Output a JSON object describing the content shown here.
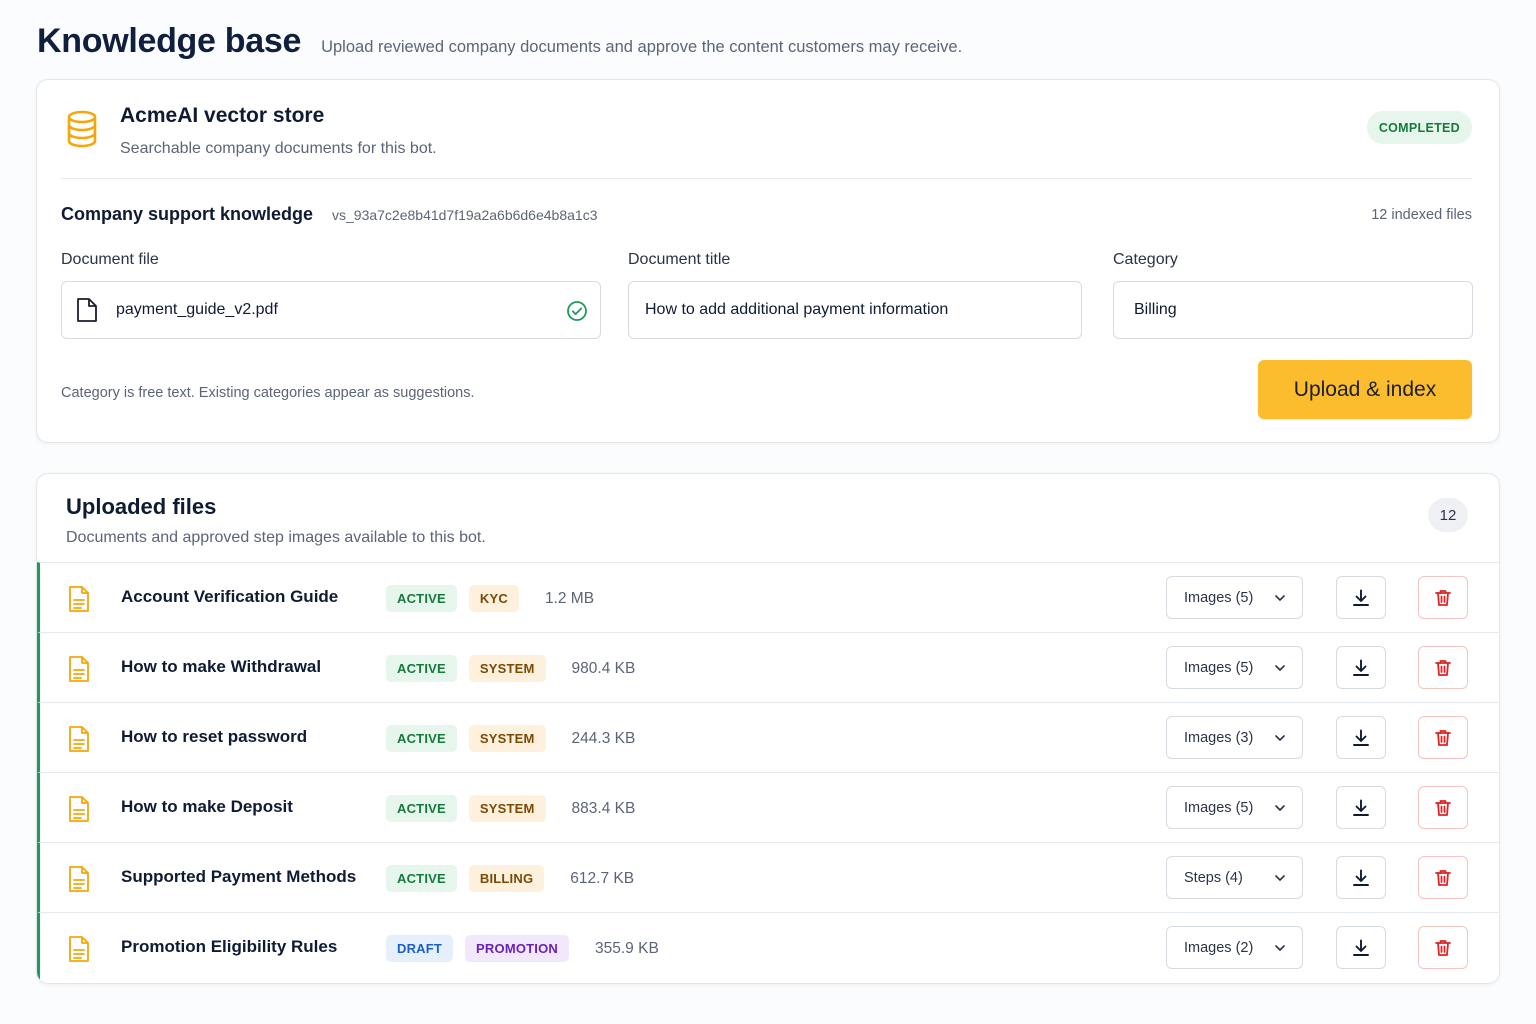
{
  "header": {
    "title": "Knowledge base",
    "subtitle": "Upload reviewed company documents and approve the content customers may receive."
  },
  "store": {
    "icon": "database-icon",
    "name": "AcmeAI vector store",
    "description": "Searchable company documents for this bot.",
    "status": "COMPLETED",
    "knowledge_name": "Company support knowledge",
    "store_id": "vs_93a7c2e8b41d7f19a2a6b6d6e4b8a1c3",
    "indexed_count": "12 indexed files"
  },
  "form": {
    "file_label": "Document file",
    "file_value": "payment_guide_v2.pdf",
    "title_label": "Document title",
    "title_value": "How to add additional payment information",
    "category_label": "Category",
    "category_value": "Billing",
    "hint": "Category is free text. Existing categories appear as suggestions.",
    "upload_label": "Upload & index"
  },
  "files": {
    "title": "Uploaded files",
    "description": "Documents and approved step images available to this bot.",
    "count": "12",
    "rows": [
      {
        "name": "Account Verification Guide",
        "status": "ACTIVE",
        "category": "KYC",
        "size": "1.2 MB",
        "media": "Images (5)"
      },
      {
        "name": "How to make Withdrawal",
        "status": "ACTIVE",
        "category": "SYSTEM",
        "size": "980.4 KB",
        "media": "Images (5)"
      },
      {
        "name": "How to reset password",
        "status": "ACTIVE",
        "category": "SYSTEM",
        "size": "244.3 KB",
        "media": "Images (3)"
      },
      {
        "name": "How to make Deposit",
        "status": "ACTIVE",
        "category": "SYSTEM",
        "size": "883.4 KB",
        "media": "Images (5)"
      },
      {
        "name": "Supported Payment Methods",
        "status": "ACTIVE",
        "category": "BILLING",
        "size": "612.7 KB",
        "media": "Steps (4)"
      },
      {
        "name": "Promotion Eligibility Rules",
        "status": "DRAFT",
        "category": "PROMOTION",
        "size": "355.9 KB",
        "media": "Images (2)"
      }
    ]
  },
  "colors": {
    "accent": "#fbbd2e",
    "active_bg": "#e7f6ec",
    "active_fg": "#157a3c",
    "draft_bg": "#e6f0fc",
    "draft_fg": "#1d5fc2",
    "category_bg": "#fdf1de",
    "category_fg": "#7a4a05",
    "promotion_bg": "#f1e8fb",
    "promotion_fg": "#6a21b5",
    "danger": "#dc2626"
  }
}
